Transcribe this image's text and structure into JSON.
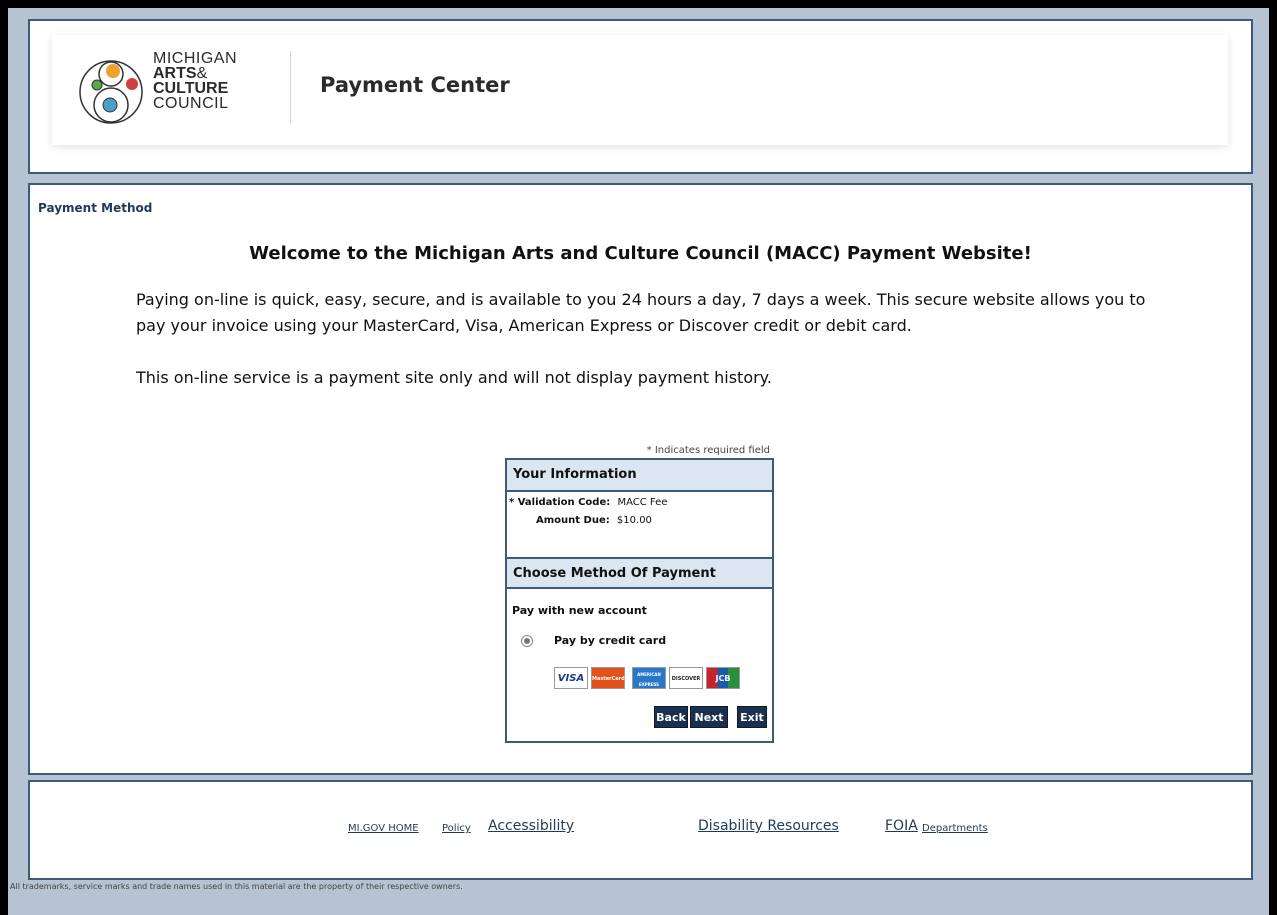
{
  "header": {
    "logo_lines": [
      "MICHIGAN",
      "ARTS",
      "&",
      "CULTURE",
      "COUNCIL"
    ],
    "app_title": "Payment Center"
  },
  "main": {
    "section_label": "Payment Method",
    "welcome_title": "Welcome to the Michigan Arts and Culture Council (MACC) Payment Website!",
    "intro_paragraph": "Paying on-line is quick, easy, secure, and is available to you 24 hours a day, 7 days a week. This secure website allows you to pay your invoice using your MasterCard, Visa, American Express or Discover credit or debit card.",
    "history_note": "This on-line service is a payment site only and will not display payment history."
  },
  "payment_form": {
    "required_note": "* Indicates required field",
    "info_heading": "Your Information",
    "validation_label": "* Validation Code:",
    "validation_value": "MACC Fee",
    "amount_label": "Amount Due:",
    "amount_value": "$10.00",
    "method_heading": "Choose Method Of Payment",
    "new_account_label": "Pay with new account",
    "credit_card_label": "Pay by credit card",
    "cards": [
      "VISA",
      "MasterCard",
      "AMERICAN EXPRESS",
      "DISCOVER",
      "JCB"
    ],
    "buttons": {
      "back": "Back",
      "next": "Next",
      "exit": "Exit"
    }
  },
  "footer": {
    "links": {
      "home": "MI.GOV HOME",
      "policy": "Policy",
      "accessibility": "Accessibility",
      "disability": "Disability Resources",
      "foia": "FOIA",
      "departments": "Departments"
    },
    "disclaimer": "All trademarks, service marks and trade names used in this material are the property of their respective owners."
  },
  "colors": {
    "frame_bg": "#b5c3d3",
    "panel_border": "#3e5a79",
    "box_header_bg": "#dce6f1",
    "button_bg": "#1b2f4e",
    "link_color": "#1f3a5a"
  }
}
